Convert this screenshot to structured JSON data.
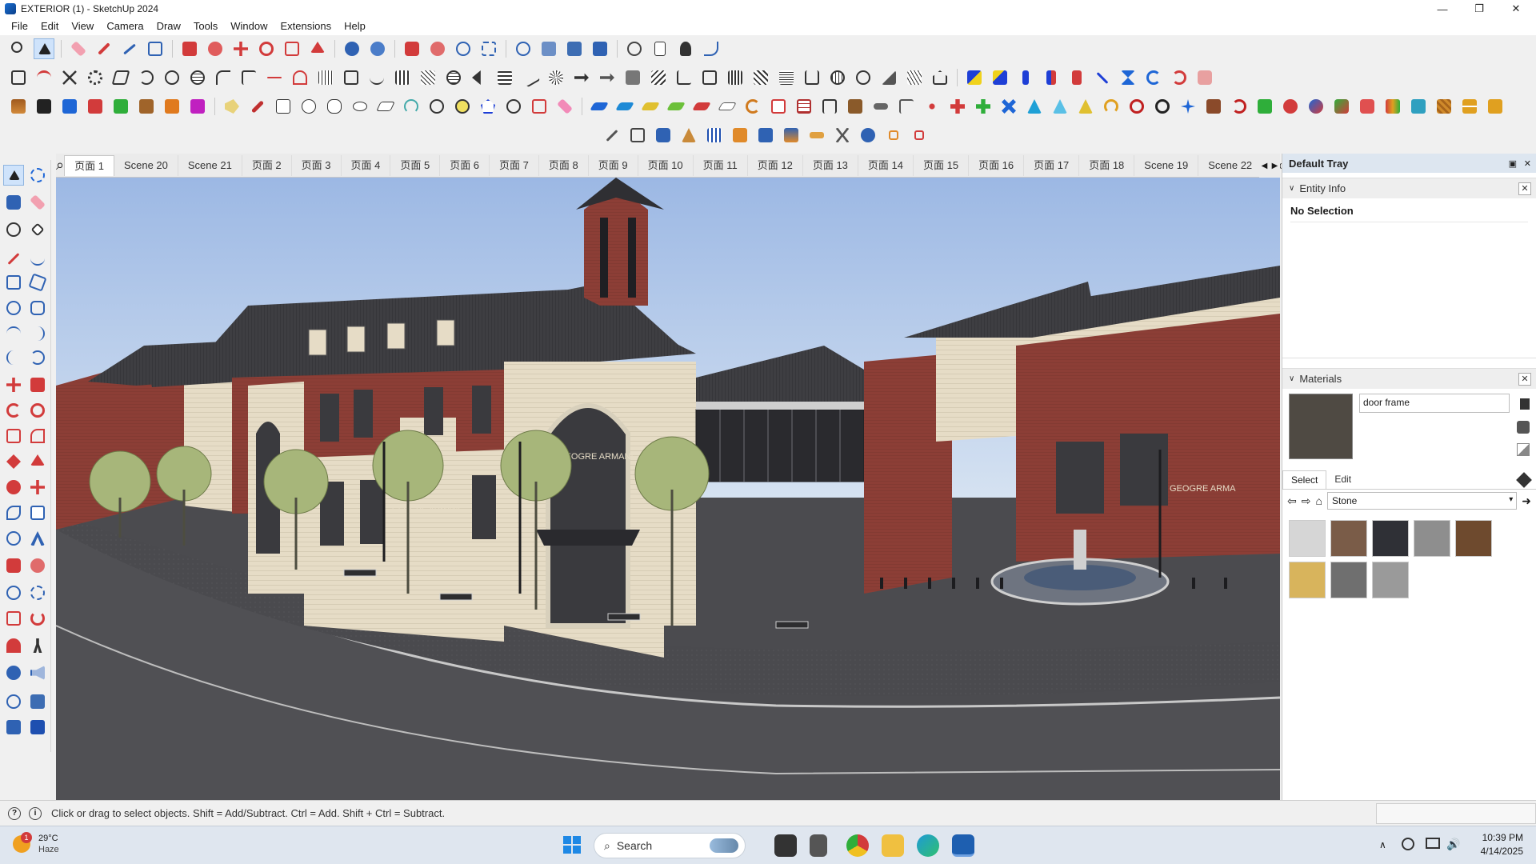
{
  "window": {
    "title": "EXTERIOR  (1) - SketchUp 2024",
    "minimize": "—",
    "maximize": "❐",
    "close": "✕"
  },
  "menu": [
    "File",
    "Edit",
    "View",
    "Camera",
    "Draw",
    "Tools",
    "Window",
    "Extensions",
    "Help"
  ],
  "scenes": {
    "tabs": [
      "页面 1",
      "Scene 20",
      "Scene 21",
      "页面 2",
      "页面 3",
      "页面 4",
      "页面 5",
      "页面 6",
      "页面 7",
      "页面 8",
      "页面 9",
      "页面 10",
      "页面 11",
      "页面 12",
      "页面 13",
      "页面 14",
      "页面 15",
      "页面 16",
      "页面 17",
      "页面 18",
      "Scene 19",
      "Scene 22",
      "Sc"
    ],
    "active_index": 0
  },
  "tray": {
    "title": "Default Tray",
    "entity_info": {
      "header": "Entity Info",
      "selection": "No Selection"
    },
    "materials": {
      "header": "Materials",
      "name_value": "door frame",
      "current_color": "#4f4a43",
      "tabs": [
        "Select",
        "Edit"
      ],
      "library": "Stone",
      "swatches": [
        "#d6d6d6",
        "#7a5c48",
        "#2f3036",
        "#8e8e8e",
        "#6e4a2e",
        "#d8b45c",
        "#6f6f6f",
        "#9a9a9a"
      ]
    }
  },
  "status": {
    "message": "Click or drag to select objects. Shift = Add/Subtract. Ctrl = Add. Shift + Ctrl = Subtract."
  },
  "taskbar": {
    "weather_temp": "29°C",
    "weather_desc": "Haze",
    "weather_badge": "1",
    "search_placeholder": "Search",
    "time": "10:39 PM",
    "date": "4/14/2025"
  },
  "scene_signage": [
    "GEOGRE ARMANI",
    "GEOGRE ARMANI",
    "GEOGRE ARMA"
  ]
}
